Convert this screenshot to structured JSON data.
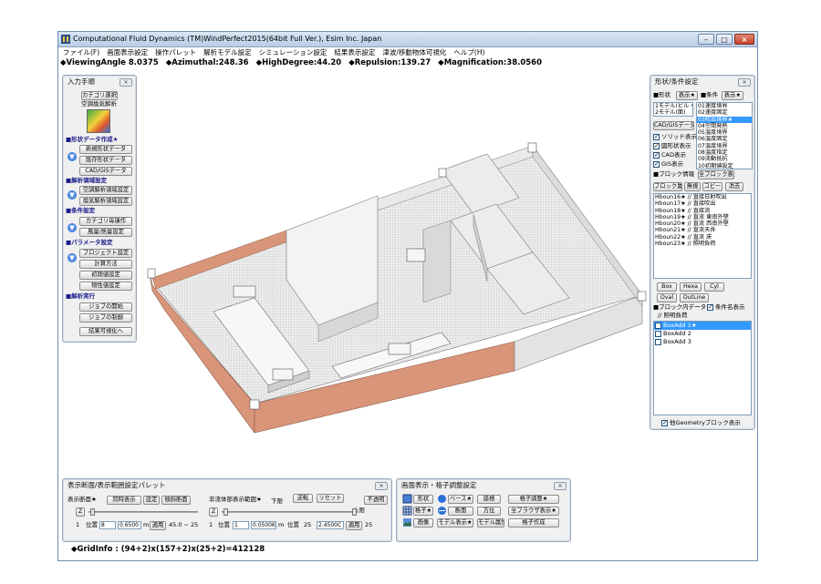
{
  "window": {
    "title": "Computational Fluid Dynamics (TM)WindPerfect2015(64bit Full Ver.), Esim Inc. Japan",
    "controls": [
      "minimize",
      "maximize",
      "close"
    ]
  },
  "menu": [
    "ファイル(F)",
    "画面表示設定",
    "操作パレット",
    "解析モデル設定",
    "シミュレーション設定",
    "結果表示設定",
    "津波/移動物体可視化",
    "ヘルプ(H)"
  ],
  "status": {
    "viewing_angle": "◆ViewingAngle 8.0375",
    "azimuthal": "◆Azimuthal:248.36",
    "high_degree": "◆HighDegree:44.20",
    "repulsion": "◆Repulsion:139.27",
    "magnification": "◆Magnification:38.0560"
  },
  "input_panel": {
    "title": "入力手順",
    "category_button": "カテゴリ選択",
    "category_name": "空調換気解析",
    "sections": {
      "shape": "■形状データ作成★",
      "analysis": "■解析領域設定",
      "conditions": "■条件設定",
      "params": "■パラメータ設定",
      "run": "■解析実行"
    },
    "buttons": {
      "new_shape": "新規形状データ",
      "existing_shape": "既存形状データ",
      "cad_gis": "CAD/GISデータ",
      "ac_region": "空調解析領域設定",
      "vent_region": "換気解析領域設定",
      "category_op": "カテゴリ毎操作",
      "wind_heat": "風量/熱量設定",
      "project": "プロジェクト設定",
      "method": "計算方法",
      "initial": "初期値設定",
      "property": "物性値設定",
      "job_start": "ジョブの開始",
      "job_control": "ジョブの制御",
      "visualize": "結果可視化へ"
    }
  },
  "shape_panel": {
    "title": "形状/条件設定",
    "shape_label": "■形状",
    "display_btn": "表示★",
    "cond_label": "■条件",
    "cond_display_btn": "表示★",
    "model_items": [
      "1モデル(ビル・)",
      "2モデル(面)"
    ],
    "condition_items": [
      "01速度境界",
      "02速度固定",
      "03吹出境界★",
      "04空間発熱",
      "05温度境界",
      "06温度固定",
      "07温度境界",
      "08温度指定",
      "09流動抵抗",
      "10初期値設定"
    ],
    "selected_condition_index": 2,
    "cad_gis_btn": "CAD/GISデータ",
    "checks": [
      {
        "label": "ソリッド表示",
        "on": true
      },
      {
        "label": "図形状表示",
        "on": true
      },
      {
        "label": "CAD表示",
        "on": true
      },
      {
        "label": "GIS表示",
        "on": true
      }
    ],
    "block_info_label": "■ブロック情報",
    "all_block_btn": "全ブロック表示",
    "block_attr_btn": "ブロック属性",
    "none_btn": "無視",
    "copy_btn": "コピー",
    "delete_btn": "消去",
    "blocks": [
      "Hboun16★ // 直接日射吹出",
      "Hboun17★ // 直接吹出",
      "Hboun18★ // 直接流",
      "Hboun19★ // 直流 東南外壁",
      "Hboun20★ // 直流 西南外壁",
      "Hboun21★ // 直流天井",
      "Hboun22★ // 直流 床",
      "Hboun23★ // 照明負荷"
    ],
    "shape_buttons": [
      "Box",
      "Hexa",
      "Cyl",
      "Oval",
      "OutLine"
    ],
    "block_data_label": "■ブロック内データ",
    "cond_name_check": "条件名表示",
    "cond_name_on": true,
    "block_subtitle": "// 照明負荷",
    "boxes": [
      {
        "label": "BoxAdd 1★",
        "selected": true
      },
      {
        "label": "BoxAdd 2",
        "selected": false
      },
      {
        "label": "BoxAdd 3",
        "selected": false
      }
    ],
    "other_geom_check": "他Geometryブロック表示",
    "other_geom_on": true
  },
  "section_panel": {
    "title": "表示断面/表示範囲設定パレット",
    "disp_section_label": "表示断面★",
    "simul_btn": "同時表示",
    "settings_btn": "設定",
    "oblique_btn": "傾斜断面",
    "fluid_label": "非流体部表示範囲★",
    "lower_label": "下限",
    "upper_label": "上限",
    "invert_btn": "逆転",
    "reset_btn": "リセット",
    "opaque_btn": "不透明",
    "axis_left": "Z",
    "axis_right": "Z",
    "row_left": {
      "n": "1",
      "pos_label": "位置",
      "pos": "8",
      "val": "0.6500",
      "unit": "m",
      "apply": "適用",
      "range": "45.0 ~ 25"
    },
    "row_right": {
      "n": "1",
      "pos_label": "位置",
      "pos": "1",
      "val": "0.0500K",
      "unit": "m",
      "pos2_label": "位置",
      "pos2": "25",
      "val2": "2.4500C",
      "apply": "適用",
      "end": "25"
    }
  },
  "display_panel": {
    "title": "画面表示・格子調整設定",
    "row1": [
      "形状",
      "ベース★",
      "座標",
      "格子調整★"
    ],
    "row2": [
      "格子★",
      "断面",
      "方位",
      "全ブラウザ表示★"
    ],
    "row3": [
      "画像",
      "モデル表示★",
      "モデル属性",
      "格子作成"
    ]
  },
  "grid_info": "◆GridInfo : (94+2)x(157+2)x(25+2)=412128",
  "colors": {
    "accent_blue": "#1d5fc4",
    "selection": "#3399ff",
    "wall_orange": "#d9957a",
    "floor": "#e7e7e7"
  }
}
